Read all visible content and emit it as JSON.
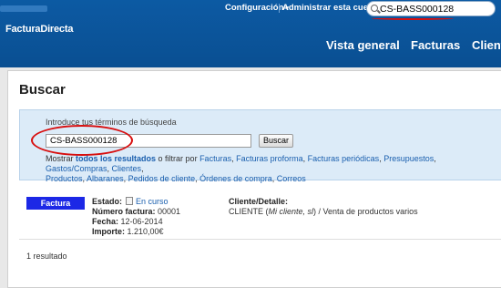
{
  "header": {
    "brand": "FacturaDirecta",
    "menu": {
      "config_label": "Configuración",
      "admin_label": "Administrar esta cuenta"
    },
    "global_search_value": "CS-BASS000128",
    "nav": [
      "Vista general",
      "Facturas",
      "Clientes"
    ]
  },
  "page": {
    "title": "Buscar",
    "search": {
      "hint": "Introduce tus términos de búsqueda",
      "query_value": "CS-BASS000128",
      "button_label": "Buscar"
    },
    "filters": {
      "prefix": "Mostrar",
      "all_label": "todos los resultados",
      "middle": " o filtrar por ",
      "links": [
        "Facturas",
        "Facturas proforma",
        "Facturas periódicas",
        "Presupuestos",
        "Gastos/Compras",
        "Clientes",
        "Productos",
        "Albaranes",
        "Pedidos de cliente",
        "Órdenes de compra",
        "Correos"
      ]
    },
    "result": {
      "badge": "Factura",
      "estado_label": "Estado:",
      "estado_value": "En curso",
      "numero_label": "Número factura:",
      "numero_value": "00001",
      "fecha_label": "Fecha:",
      "fecha_value": "12-06-2014",
      "importe_label": "Importe:",
      "importe_value": "1.210,00€",
      "cliente_heading": "Cliente/Detalle:",
      "cliente_name": "CLIENTE (",
      "cliente_italic": "Mi cliente, sl",
      "cliente_rest": ") / Venta de productos varios"
    },
    "count": "1 resultado"
  },
  "colors": {
    "header_blue": "#0c5aa3",
    "badge_blue": "#1c28e6",
    "annotation_red": "#d80f0f",
    "link_blue": "#1a5fae"
  }
}
